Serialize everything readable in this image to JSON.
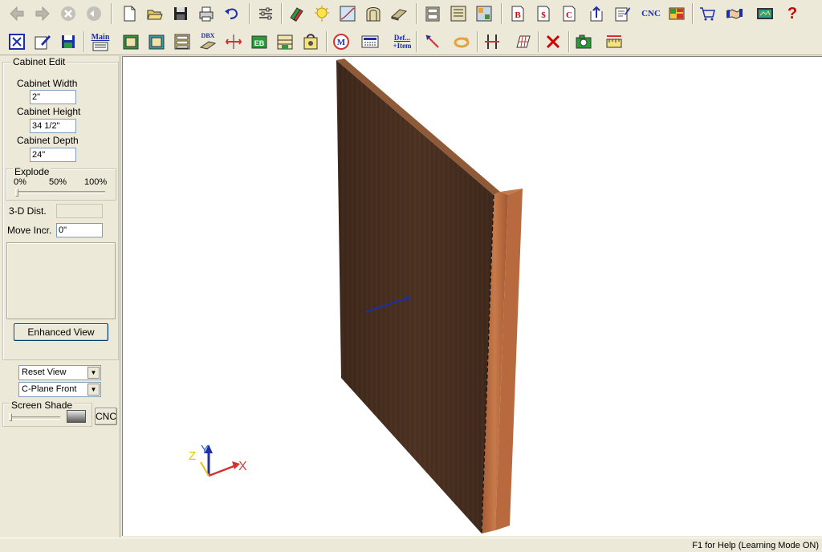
{
  "toolbar_row1": {
    "buttons": [
      {
        "name": "back-icon",
        "label": ""
      },
      {
        "name": "forward-icon",
        "label": ""
      },
      {
        "name": "stop-icon",
        "label": ""
      },
      {
        "name": "refresh-icon",
        "label": ""
      },
      {
        "name": "new-file-icon",
        "label": ""
      },
      {
        "name": "open-folder-icon",
        "label": ""
      },
      {
        "name": "save-icon",
        "label": ""
      },
      {
        "name": "print-icon",
        "label": ""
      },
      {
        "name": "undo-icon",
        "label": ""
      },
      {
        "name": "settings-sliders-icon",
        "label": ""
      },
      {
        "name": "materials-icon",
        "label": ""
      },
      {
        "name": "light-bulb-icon",
        "label": ""
      },
      {
        "name": "graph-icon",
        "label": ""
      },
      {
        "name": "arch-door-icon",
        "label": ""
      },
      {
        "name": "panel-icon",
        "label": ""
      },
      {
        "name": "cabinet-icon",
        "label": ""
      },
      {
        "name": "cabinet-list-icon",
        "label": ""
      },
      {
        "name": "layout-icon",
        "label": ""
      },
      {
        "name": "bid-report-icon",
        "label": "B"
      },
      {
        "name": "cost-report-icon",
        "label": "$"
      },
      {
        "name": "cutlist-report-icon",
        "label": "C"
      },
      {
        "name": "export-icon",
        "label": ""
      },
      {
        "name": "edit-report-icon",
        "label": ""
      },
      {
        "name": "cnc-text-icon",
        "label": "CNC"
      },
      {
        "name": "sheet-layout-icon",
        "label": ""
      },
      {
        "name": "cart-icon",
        "label": ""
      },
      {
        "name": "handshake-icon",
        "label": ""
      },
      {
        "name": "screen-icon",
        "label": ""
      },
      {
        "name": "help-icon",
        "label": "?"
      }
    ]
  },
  "toolbar_row2": {
    "main_label": "Main",
    "dbx_label": "DBX",
    "eb_label": "EB",
    "def_label": "Def...",
    "item_label": "+Item"
  },
  "side_panel": {
    "cabinet_edit": {
      "title": "Cabinet Edit",
      "width_label": "Cabinet Width",
      "width_value": "2\"",
      "height_label": "Cabinet Height",
      "height_value": "34 1/2\"",
      "depth_label": "Cabinet Depth",
      "depth_value": "24\""
    },
    "explode": {
      "title": "Explode",
      "tick_0": "0%",
      "tick_50": "50%",
      "tick_100": "100%",
      "level": 0
    },
    "dist_label": "3-D Dist.",
    "dist_value": "",
    "move_label": "Move Incr.",
    "move_value": "0\"",
    "enhanced_view_label": "Enhanced View",
    "view_select": "Reset View",
    "plane_select": "C-Plane Front",
    "shade": {
      "title": "Screen Shade",
      "level": 0
    },
    "cnc_label": "CNC"
  },
  "viewport": {
    "axis_x": "X",
    "axis_y": "Y",
    "axis_z": "Z"
  },
  "status_bar": {
    "text": "F1 for Help (Learning Mode ON)"
  },
  "colors": {
    "panel_face": "#4a3022",
    "panel_edge": "#b86a3e",
    "panel_top": "#8e5a38",
    "window_bg": "#ece9d8"
  }
}
